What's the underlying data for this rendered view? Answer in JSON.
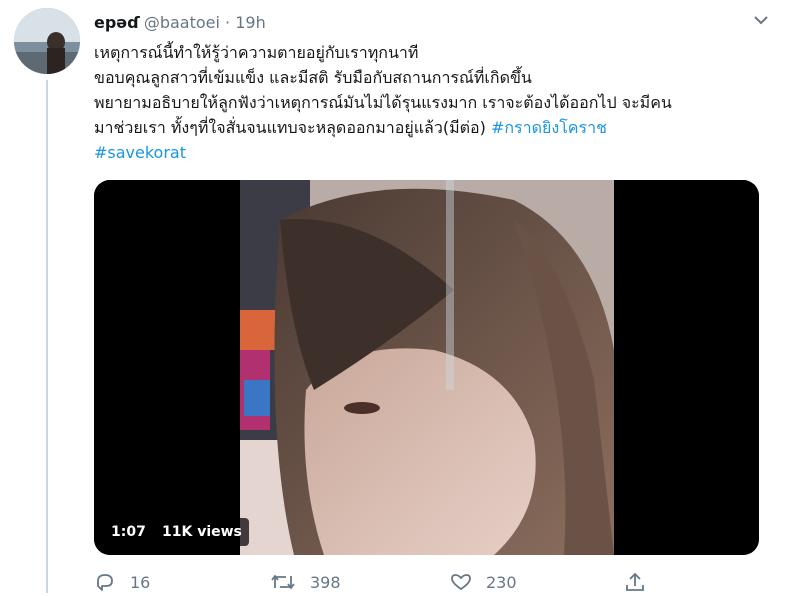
{
  "tweet": {
    "display_name": "epəɗ",
    "handle": "@baatoei",
    "separator": "·",
    "time": "19h",
    "text_lines": [
      "เหตุการณ์นี้ทำให้รู้ว่าความตายอยู่กับเราทุกนาที",
      "ขอบคุณลูกสาวที่เข้มแข็ง และมีสติ รับมือกับสถานการณ์ที่เกิดขึ้น",
      "พยายามอธิบายให้ลูกฟังว่าเหตุการณ์มันไม่ได้รุนแรงมาก เราจะต้องได้ออกไป จะมีคน"
    ],
    "text_line4": "มาช่วยเรา ทั้งๆที่ใจสั่นจนแทบจะหลุดออกมาอยู่แล้ว(มีต่อ) ",
    "hashtag1": "#กราดยิงโคราช",
    "hashtag2": "#savekorat",
    "video": {
      "duration": "1:07",
      "views": "11K views"
    },
    "actions": {
      "replies": "16",
      "retweets": "398",
      "likes": "230"
    }
  },
  "colors": {
    "link": "#1b95e0",
    "secondary_text": "#657786",
    "primary_text": "#14171a"
  },
  "icons": [
    "chevron-down-icon",
    "reply-icon",
    "retweet-icon",
    "like-icon",
    "share-icon"
  ]
}
